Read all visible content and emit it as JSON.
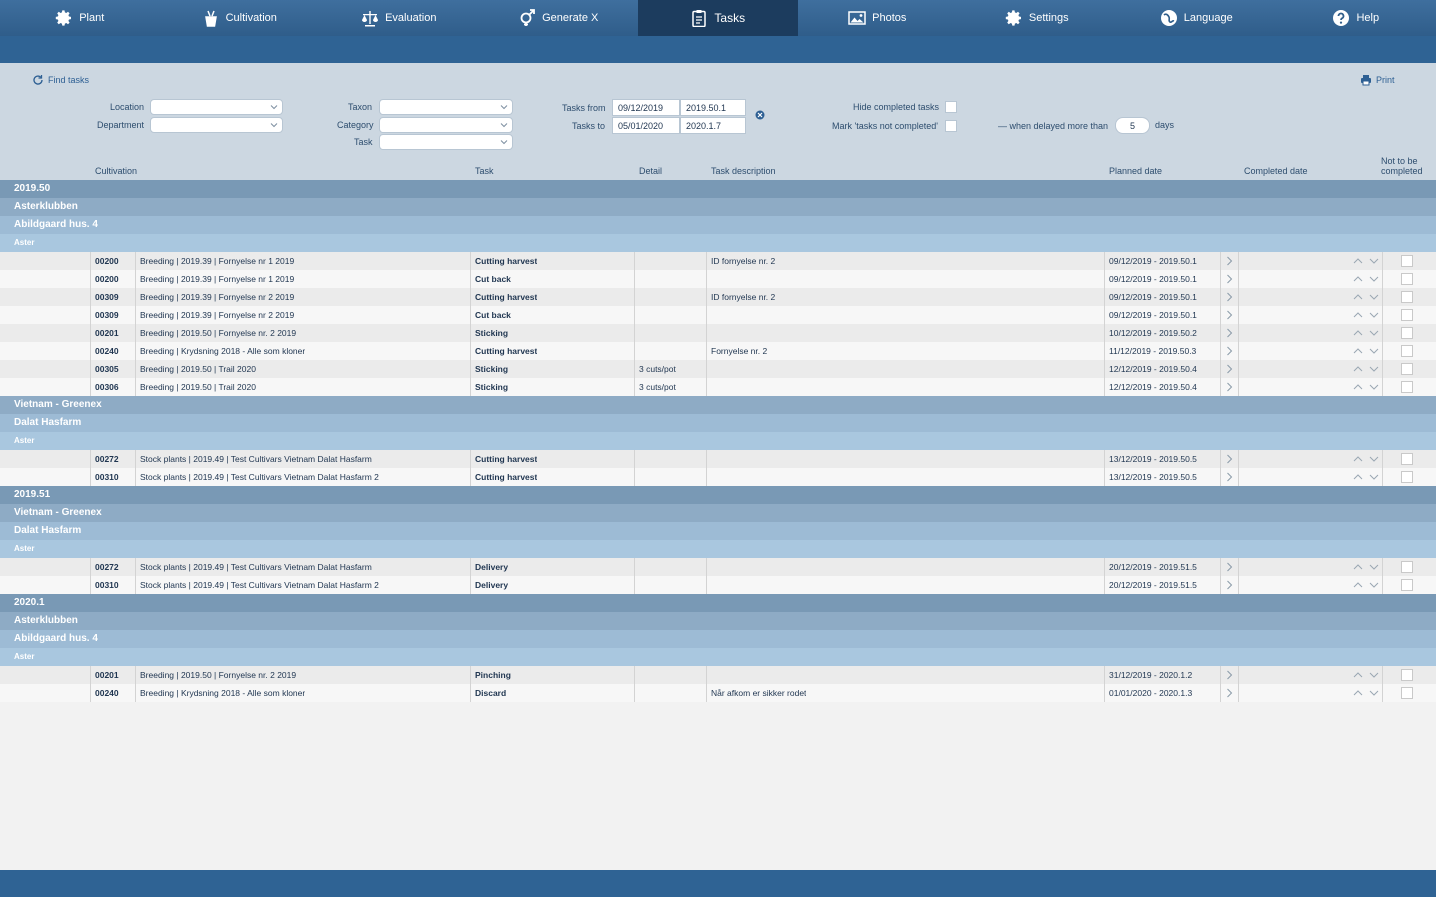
{
  "nav": [
    {
      "label": "Plant",
      "icon": "gear-icon"
    },
    {
      "label": "Cultivation",
      "icon": "pot-icon"
    },
    {
      "label": "Evaluation",
      "icon": "scale-icon"
    },
    {
      "label": "Generate X",
      "icon": "gender-icon"
    },
    {
      "label": "Tasks",
      "icon": "clipboard-icon"
    },
    {
      "label": "Photos",
      "icon": "photo-icon"
    },
    {
      "label": "Settings",
      "icon": "gear-icon"
    },
    {
      "label": "Language",
      "icon": "globe-icon"
    },
    {
      "label": "Help",
      "icon": "help-icon"
    }
  ],
  "active_tab": "Tasks",
  "toolbar": {
    "find_label": "Find tasks",
    "print_label": "Print"
  },
  "filters": {
    "location_label": "Location",
    "department_label": "Department",
    "taxon_label": "Taxon",
    "category_label": "Category",
    "task_label": "Task",
    "tasks_from_label": "Tasks from",
    "tasks_to_label": "Tasks to",
    "from_date": "09/12/2019",
    "from_week": "2019.50.1",
    "to_date": "05/01/2020",
    "to_week": "2020.1.7",
    "hide_completed_label": "Hide completed tasks",
    "mark_not_completed_label": "Mark 'tasks not completed'",
    "delayed_label": "— when delayed more than",
    "delayed_days": "5",
    "days_label": "days"
  },
  "columns": {
    "cultivation": "Cultivation",
    "task": "Task",
    "detail": "Detail",
    "description": "Task description",
    "planned": "Planned date",
    "completed": "Completed date",
    "not_completed_1": "Not to be",
    "not_completed_2": "completed"
  },
  "rows": [
    {
      "type": "g0",
      "label": "2019.50"
    },
    {
      "type": "g1",
      "label": "Asterklubben"
    },
    {
      "type": "g2",
      "label": "Abildgaard hus. 4"
    },
    {
      "type": "g3",
      "label": "Aster"
    },
    {
      "type": "data",
      "num": "00200",
      "cult": "Breeding  |  2019.39  |  Fornyelse nr 1 2019",
      "task": "Cutting harvest",
      "detail": "",
      "desc": "ID  fornyelse nr. 2",
      "planned": "09/12/2019 - 2019.50.1"
    },
    {
      "type": "data",
      "num": "00200",
      "cult": "Breeding  |  2019.39  |  Fornyelse nr 1 2019",
      "task": "Cut back",
      "detail": "",
      "desc": "",
      "planned": "09/12/2019 - 2019.50.1"
    },
    {
      "type": "data",
      "num": "00309",
      "cult": "Breeding  |  2019.39  |  Fornyelse nr 2 2019",
      "task": "Cutting harvest",
      "detail": "",
      "desc": "ID  fornyelse nr. 2",
      "planned": "09/12/2019 - 2019.50.1"
    },
    {
      "type": "data",
      "num": "00309",
      "cult": "Breeding  |  2019.39  |  Fornyelse nr 2 2019",
      "task": "Cut back",
      "detail": "",
      "desc": "",
      "planned": "09/12/2019 - 2019.50.1"
    },
    {
      "type": "data",
      "num": "00201",
      "cult": "Breeding  |  2019.50  |  Fornyelse nr. 2 2019",
      "task": "Sticking",
      "detail": "",
      "desc": "",
      "planned": "10/12/2019 - 2019.50.2"
    },
    {
      "type": "data",
      "num": "00240",
      "cult": "Breeding  |  Krydsning 2018 - Alle som kloner",
      "task": "Cutting harvest",
      "detail": "",
      "desc": "Fornyelse nr. 2",
      "planned": "11/12/2019 - 2019.50.3"
    },
    {
      "type": "data",
      "num": "00305",
      "cult": "Breeding  |  2019.50  |  Trail 2020",
      "task": "Sticking",
      "detail": "3 cuts/pot",
      "desc": "",
      "planned": "12/12/2019 - 2019.50.4"
    },
    {
      "type": "data",
      "num": "00306",
      "cult": "Breeding  |  2019.50  |  Trail 2020",
      "task": "Sticking",
      "detail": "3 cuts/pot",
      "desc": "",
      "planned": "12/12/2019 - 2019.50.4"
    },
    {
      "type": "g1",
      "label": "Vietnam - Greenex"
    },
    {
      "type": "g2",
      "label": "Dalat Hasfarm"
    },
    {
      "type": "g3",
      "label": "Aster"
    },
    {
      "type": "data",
      "num": "00272",
      "cult": "Stock plants  |  2019.49  |  Test Cultivars Vietnam Dalat Hasfarm",
      "task": "Cutting harvest",
      "detail": "",
      "desc": "",
      "planned": "13/12/2019 - 2019.50.5"
    },
    {
      "type": "data",
      "num": "00310",
      "cult": "Stock plants  |  2019.49  |  Test Cultivars Vietnam Dalat Hasfarm 2",
      "task": "Cutting harvest",
      "detail": "",
      "desc": "",
      "planned": "13/12/2019 - 2019.50.5"
    },
    {
      "type": "g0",
      "label": "2019.51"
    },
    {
      "type": "g1",
      "label": "Vietnam - Greenex"
    },
    {
      "type": "g2",
      "label": "Dalat Hasfarm"
    },
    {
      "type": "g3",
      "label": "Aster"
    },
    {
      "type": "data",
      "num": "00272",
      "cult": "Stock plants  |  2019.49  |  Test Cultivars Vietnam Dalat Hasfarm",
      "task": "Delivery",
      "detail": "",
      "desc": "",
      "planned": "20/12/2019 - 2019.51.5"
    },
    {
      "type": "data",
      "num": "00310",
      "cult": "Stock plants  |  2019.49  |  Test Cultivars Vietnam Dalat Hasfarm 2",
      "task": "Delivery",
      "detail": "",
      "desc": "",
      "planned": "20/12/2019 - 2019.51.5"
    },
    {
      "type": "g0",
      "label": "2020.1"
    },
    {
      "type": "g1",
      "label": "Asterklubben"
    },
    {
      "type": "g2",
      "label": "Abildgaard hus. 4"
    },
    {
      "type": "g3",
      "label": "Aster"
    },
    {
      "type": "data",
      "num": "00201",
      "cult": "Breeding  |  2019.50  |  Fornyelse nr. 2 2019",
      "task": "Pinching",
      "detail": "",
      "desc": "",
      "planned": "31/12/2019 - 2020.1.2"
    },
    {
      "type": "data",
      "num": "00240",
      "cult": "Breeding  |  Krydsning 2018 - Alle som kloner",
      "task": "Discard",
      "detail": "",
      "desc": "Når afkom er sikker rodet",
      "planned": "01/01/2020 - 2020.1.3"
    }
  ]
}
